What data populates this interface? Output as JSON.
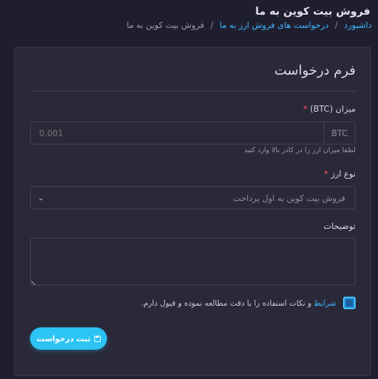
{
  "page": {
    "title": "فروش بیت کوین به ما",
    "breadcrumb": [
      {
        "label": "داشبورد"
      },
      {
        "label": "درخواست های فروش ارز به ما"
      },
      {
        "label": "فروش بیت کوین به ما"
      }
    ],
    "breadcrumb_separator": "/"
  },
  "form": {
    "title": "فرم درخواست",
    "amount": {
      "label": "میزان (BTC)",
      "required_mark": "*",
      "placeholder": "0.001",
      "addon": "BTC",
      "help": "لطفا میزان ارز را در کادر بالا وارد کنید"
    },
    "currency_type": {
      "label": "نوع ارز",
      "required_mark": "*",
      "selected": "فروش بیت کوین به اول پرداخت",
      "icon": "chevron-down-icon"
    },
    "description": {
      "label": "توضیحات",
      "value": ""
    },
    "terms": {
      "link": "شرایط",
      "text": "و نکات استفاده را با دقت مطالعه نموده و قبول دارم.",
      "checked": true
    },
    "submit": {
      "label": "ثبت درخواست",
      "icon": "save-icon"
    }
  },
  "colors": {
    "background": "#1f1e2e",
    "card": "#2a2939",
    "accent": "#2cc3f5",
    "link": "#3fb6ff",
    "required": "#ff4d6a"
  }
}
